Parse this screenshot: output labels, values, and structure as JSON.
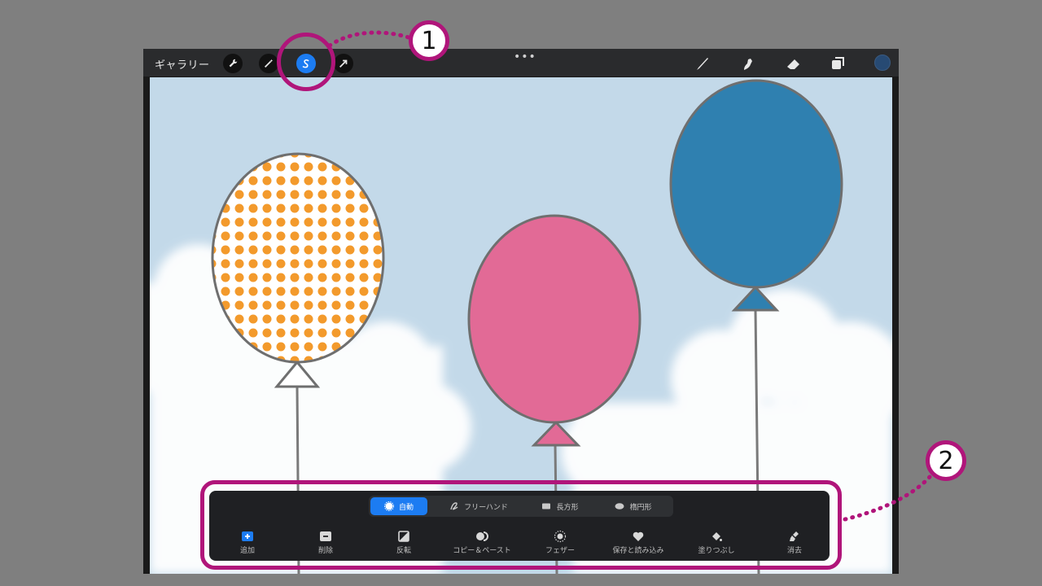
{
  "topbar": {
    "gallery_label": "ギャラリー",
    "more_label": "•••",
    "left_tools": [
      {
        "name": "actions",
        "icon": "wrench-icon"
      },
      {
        "name": "adjustments",
        "icon": "magic-wand-icon"
      },
      {
        "name": "selection",
        "icon": "selection-s-icon",
        "active": true
      },
      {
        "name": "transform",
        "icon": "arrow-cursor-icon"
      }
    ],
    "right_tools": [
      {
        "name": "brush",
        "icon": "brush-icon"
      },
      {
        "name": "smudge",
        "icon": "smudge-icon"
      },
      {
        "name": "eraser",
        "icon": "eraser-icon"
      },
      {
        "name": "layers",
        "icon": "layers-icon"
      }
    ],
    "current_color": "#274a73"
  },
  "selection_panel": {
    "modes": [
      {
        "label": "自動",
        "icon": "auto-icon",
        "active": true
      },
      {
        "label": "フリーハンド",
        "icon": "freehand-icon",
        "active": false
      },
      {
        "label": "長方形",
        "icon": "rectangle-icon",
        "active": false
      },
      {
        "label": "楕円形",
        "icon": "ellipse-icon",
        "active": false
      }
    ],
    "actions": [
      {
        "label": "追加",
        "icon": "add-icon"
      },
      {
        "label": "削除",
        "icon": "remove-icon"
      },
      {
        "label": "反転",
        "icon": "invert-icon"
      },
      {
        "label": "コピー＆ペースト",
        "icon": "copy-paste-icon"
      },
      {
        "label": "フェザー",
        "icon": "feather-icon"
      },
      {
        "label": "保存と読み込み",
        "icon": "heart-icon"
      },
      {
        "label": "塗りつぶし",
        "icon": "fill-bucket-icon"
      },
      {
        "label": "消去",
        "icon": "clear-broom-icon"
      }
    ]
  },
  "annotations": {
    "badge_1": "1",
    "badge_2": "2"
  },
  "colors": {
    "accent": "#1c7cf2",
    "highlight": "#b0157a",
    "sky": "#c3d9e9",
    "balloon_orange": "#f39a2c",
    "balloon_pink": "#e26a96",
    "balloon_blue": "#2f80b0"
  }
}
